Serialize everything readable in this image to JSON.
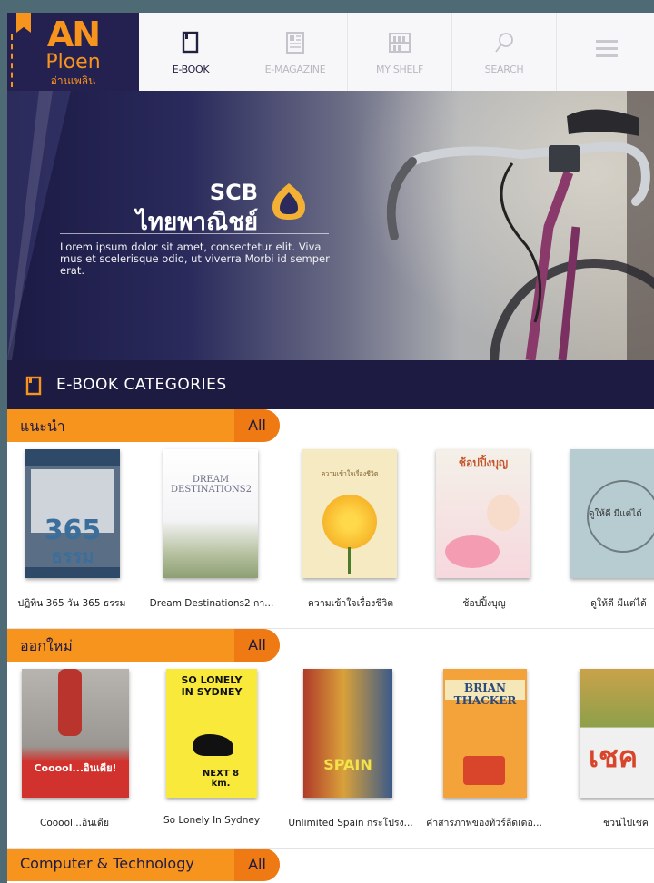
{
  "brand": {
    "name_a": "AN",
    "name_b": "Ploen",
    "name_th": "อ่านเพลิน"
  },
  "nav": {
    "items": [
      {
        "label": "E-BOOK",
        "icon": "ebook-icon",
        "active": true
      },
      {
        "label": "E-MAGAZINE",
        "icon": "magazine-icon",
        "active": false
      },
      {
        "label": "MY SHELF",
        "icon": "shelf-icon",
        "active": false
      },
      {
        "label": "SEARCH",
        "icon": "search-icon",
        "active": false
      }
    ],
    "menu_icon": "hamburger-menu-icon"
  },
  "hero": {
    "sponsor_en": "SCB",
    "sponsor_th": "ไทยพาณิชย์",
    "text": "Lorem ipsum dolor sit amet, consectetur elit. Viva mus et scelerisque odio, ut viverra Morbi id semper erat."
  },
  "categories_header": {
    "title": "E-BOOK  CATEGORIES"
  },
  "sections": [
    {
      "name": "แนะนำ",
      "all_label": "All",
      "books": [
        {
          "title": "ปฏิทิน 365 วัน 365 ธรรม"
        },
        {
          "title": "Dream Destinations2 กา..."
        },
        {
          "title": "ความเข้าใจเรื่องชีวิต"
        },
        {
          "title": "ช้อปปิ้งบุญ"
        },
        {
          "title": "ดูให้ดี มีแต่ได้"
        }
      ]
    },
    {
      "name": "ออกใหม่",
      "all_label": "All",
      "books": [
        {
          "title": "Cooool...อินเดีย"
        },
        {
          "title": "So Lonely In Sydney"
        },
        {
          "title": "Unlimited Spain กระโปรง..."
        },
        {
          "title": "คำสารภาพของทัวร์ลีดเดอ..."
        },
        {
          "title": "ชวนไปเชค"
        }
      ]
    },
    {
      "name": "Computer & Technology",
      "all_label": "All",
      "books": []
    }
  ],
  "covers": {
    "s0b0": {
      "top": "365",
      "bottom": "ธรรม"
    },
    "s0b1": {
      "text": "DREAM DESTINATIONS2"
    },
    "s0b2": {
      "text": "ความเข้าใจเรื่องชีวิต"
    },
    "s0b3": {
      "text": "ช้อปปิ้งบุญ"
    },
    "s0b4": {
      "text": "ดูให้ดี มีแต่ได้"
    },
    "s1b0": {
      "text": "Cooool...อินเดีย!"
    },
    "s1b1": {
      "text": "SO LONELY IN SYDNEY",
      "sign": "NEXT 8 km."
    },
    "s1b2": {
      "text": "SPAIN"
    },
    "s1b3": {
      "text": "BRIAN THACKER"
    },
    "s1b4": {
      "text": "เชค"
    }
  }
}
